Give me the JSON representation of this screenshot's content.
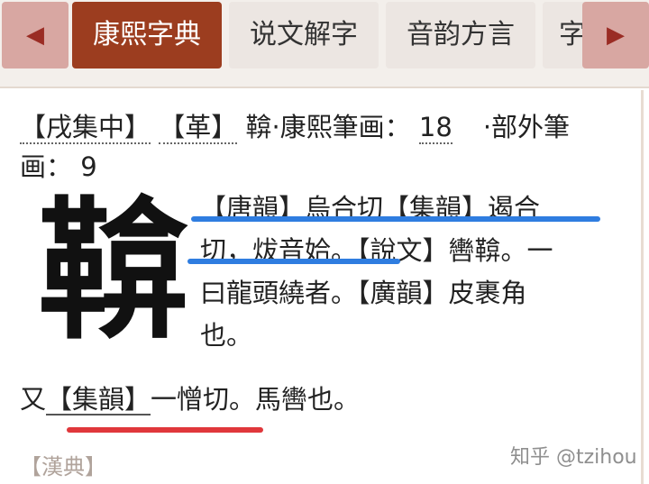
{
  "tabs": {
    "prev_arrow": "◀",
    "next_arrow": "▶",
    "items": [
      {
        "label": "康熙字典",
        "active": true
      },
      {
        "label": "说文解字",
        "active": false
      },
      {
        "label": "音韵方言",
        "active": false
      },
      {
        "label": "字",
        "active": false
      }
    ]
  },
  "entry": {
    "collection_tag": "【戌集中】",
    "radical_tag": "【革】",
    "char_label": "鞥·康熙筆画：",
    "stroke_count": "18",
    "outside_label": "·部外筆",
    "outside_label_2": "画：",
    "outside_count": "9",
    "character": "鞥",
    "definition_lines": [
      "【唐韻】烏合切【集韻】遏合",
      "切，炦音姶。【說文】轡鞥。一",
      "曰龍頭繞者。【廣韻】皮裹角",
      "也。"
    ],
    "again_prefix": "又",
    "again_source": "【集韻】",
    "again_text": "一憎切。馬轡也。"
  },
  "section_label": "【漢典】",
  "watermark": "知乎 @tzihou",
  "colors": {
    "active_tab": "#9c3d1f",
    "arrow_bg": "#d8a7a2",
    "blue_mark": "#2f7de0",
    "red_mark": "#e0373b"
  }
}
